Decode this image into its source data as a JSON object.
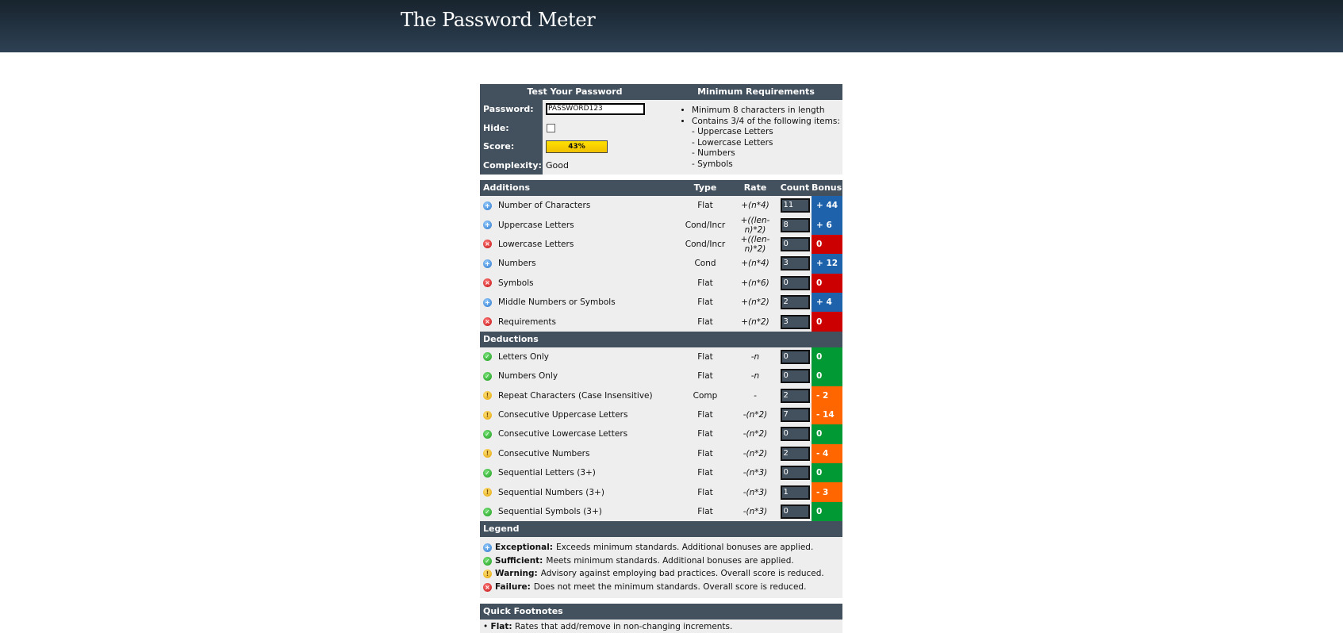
{
  "site_title": "The Password Meter",
  "test": {
    "heading": "Test Your Password",
    "labels": {
      "password": "Password:",
      "hide": "Hide:",
      "score": "Score:",
      "complexity": "Complexity:"
    },
    "password_value": "PASSWORD123",
    "hide_checked": false,
    "score_text": "43%",
    "score_fraction": 0.43,
    "complexity": "Good"
  },
  "requirements": {
    "heading": "Minimum Requirements",
    "items": [
      "Minimum 8 characters in length",
      "Contains 3/4 of the following items:"
    ],
    "sub_items": [
      "- Uppercase Letters",
      "- Lowercase Letters",
      "- Numbers",
      "- Symbols"
    ]
  },
  "columns": {
    "type": "Type",
    "rate": "Rate",
    "count": "Count",
    "bonus": "Bonus"
  },
  "additions": {
    "heading": "Additions",
    "rows": [
      {
        "status": "exceptional",
        "name": "Number of Characters",
        "type": "Flat",
        "rate": "+(n*4)",
        "count": "11",
        "bonus": "+ 44"
      },
      {
        "status": "exceptional",
        "name": "Uppercase Letters",
        "type": "Cond/Incr",
        "rate": "+((len-n)*2)",
        "count": "8",
        "bonus": "+ 6"
      },
      {
        "status": "failure",
        "name": "Lowercase Letters",
        "type": "Cond/Incr",
        "rate": "+((len-n)*2)",
        "count": "0",
        "bonus": "0"
      },
      {
        "status": "exceptional",
        "name": "Numbers",
        "type": "Cond",
        "rate": "+(n*4)",
        "count": "3",
        "bonus": "+ 12"
      },
      {
        "status": "failure",
        "name": "Symbols",
        "type": "Flat",
        "rate": "+(n*6)",
        "count": "0",
        "bonus": "0"
      },
      {
        "status": "exceptional",
        "name": "Middle Numbers or Symbols",
        "type": "Flat",
        "rate": "+(n*2)",
        "count": "2",
        "bonus": "+ 4"
      },
      {
        "status": "failure",
        "name": "Requirements",
        "type": "Flat",
        "rate": "+(n*2)",
        "count": "3",
        "bonus": "0"
      }
    ]
  },
  "deductions": {
    "heading": "Deductions",
    "rows": [
      {
        "status": "sufficient",
        "name": "Letters Only",
        "type": "Flat",
        "rate": "-n",
        "count": "0",
        "bonus": "0"
      },
      {
        "status": "sufficient",
        "name": "Numbers Only",
        "type": "Flat",
        "rate": "-n",
        "count": "0",
        "bonus": "0"
      },
      {
        "status": "warning",
        "name": "Repeat Characters (Case Insensitive)",
        "type": "Comp",
        "rate": "-",
        "count": "2",
        "bonus": "- 2"
      },
      {
        "status": "warning",
        "name": "Consecutive Uppercase Letters",
        "type": "Flat",
        "rate": "-(n*2)",
        "count": "7",
        "bonus": "- 14"
      },
      {
        "status": "sufficient",
        "name": "Consecutive Lowercase Letters",
        "type": "Flat",
        "rate": "-(n*2)",
        "count": "0",
        "bonus": "0"
      },
      {
        "status": "warning",
        "name": "Consecutive Numbers",
        "type": "Flat",
        "rate": "-(n*2)",
        "count": "2",
        "bonus": "- 4"
      },
      {
        "status": "sufficient",
        "name": "Sequential Letters (3+)",
        "type": "Flat",
        "rate": "-(n*3)",
        "count": "0",
        "bonus": "0"
      },
      {
        "status": "warning",
        "name": "Sequential Numbers (3+)",
        "type": "Flat",
        "rate": "-(n*3)",
        "count": "1",
        "bonus": "- 3"
      },
      {
        "status": "sufficient",
        "name": "Sequential Symbols (3+)",
        "type": "Flat",
        "rate": "-(n*3)",
        "count": "0",
        "bonus": "0"
      }
    ]
  },
  "legend": {
    "heading": "Legend",
    "items": [
      {
        "status": "exceptional",
        "term": "Exceptional:",
        "desc": "Exceeds minimum standards. Additional bonuses are applied."
      },
      {
        "status": "sufficient",
        "term": "Sufficient:",
        "desc": "Meets minimum standards. Additional bonuses are applied."
      },
      {
        "status": "warning",
        "term": "Warning:",
        "desc": "Advisory against employing bad practices. Overall score is reduced."
      },
      {
        "status": "failure",
        "term": "Failure:",
        "desc": "Does not meet the minimum standards. Overall score is reduced."
      }
    ]
  },
  "footnotes": {
    "heading": "Quick Footnotes",
    "first_term": "Flat:",
    "first_desc": "Rates that add/remove in non-changing increments."
  },
  "icons": {
    "exceptional": "exceptional-plus-icon",
    "sufficient": "sufficient-check-icon",
    "warning": "warning-exclamation-icon",
    "failure": "failure-x-icon"
  },
  "colors": {
    "header": "#43505d",
    "exceptional": "#1f62ac",
    "failure": "#cc0000",
    "sufficient": "#009933",
    "warning": "#ff6600",
    "score_bar": "#ffe000"
  }
}
